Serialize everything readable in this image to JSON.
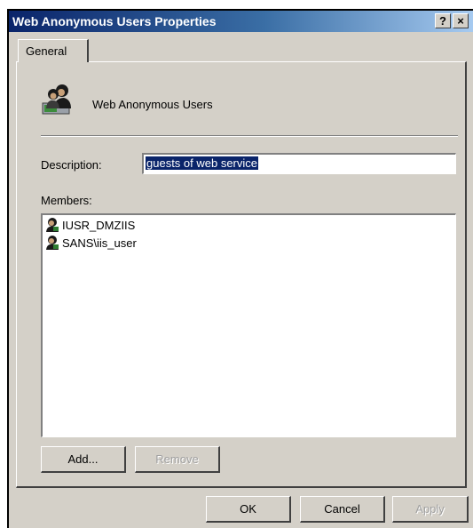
{
  "window": {
    "title": "Web Anonymous Users Properties",
    "help_label": "?",
    "close_label": "×"
  },
  "tabs": [
    {
      "label": "General",
      "selected": true
    }
  ],
  "general": {
    "group_name": "Web Anonymous Users",
    "description_label": "Description:",
    "description_value": "guests of web service",
    "members_label": "Members:",
    "members": [
      {
        "name": "IUSR_DMZIIS",
        "icon": "user-icon"
      },
      {
        "name": "SANS\\iis_user",
        "icon": "user-icon"
      }
    ],
    "add_label": "Add...",
    "remove_label": "Remove"
  },
  "footer": {
    "ok_label": "OK",
    "cancel_label": "Cancel",
    "apply_label": "Apply"
  },
  "colors": {
    "titlebar_start": "#0a246a",
    "titlebar_end": "#a6caf0",
    "face": "#d4d0c8",
    "selection": "#0a246a"
  }
}
